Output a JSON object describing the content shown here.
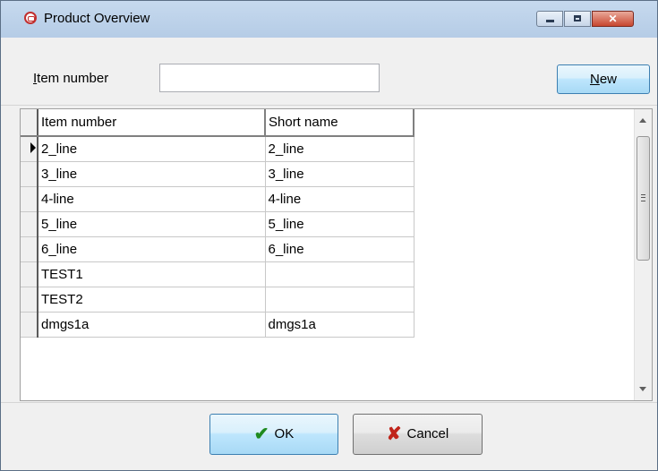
{
  "window": {
    "title": "Product Overview",
    "controls": {
      "minimize": "minimize-icon",
      "maximize": "maximize-icon",
      "close": "close-icon"
    }
  },
  "filter": {
    "label": "Item number",
    "label_mnemonic": "I",
    "label_rest": "tem number",
    "value": "",
    "new_button": {
      "mnemonic": "N",
      "rest": "ew"
    }
  },
  "grid": {
    "columns": [
      "Item number",
      "Short name"
    ],
    "selected_row": 0,
    "rows": [
      [
        "2_line",
        "2_line"
      ],
      [
        "3_line",
        "3_line"
      ],
      [
        "4-line",
        "4-line"
      ],
      [
        "5_line",
        "5_line"
      ],
      [
        "6_line",
        "6_line"
      ],
      [
        "TEST1",
        ""
      ],
      [
        "TEST2",
        ""
      ],
      [
        "dmgs1a",
        "dmgs1a"
      ]
    ]
  },
  "footer": {
    "ok_label": "OK",
    "cancel_label": "Cancel"
  },
  "icons": {
    "app": "product-app-icon",
    "ok": "checkmark-icon",
    "cancel": "red-x-icon"
  },
  "colors": {
    "titlebar": "#c6d9ee",
    "close_button": "#c8472f",
    "ok_check": "#1f8a1f",
    "cancel_x": "#c0241a"
  }
}
